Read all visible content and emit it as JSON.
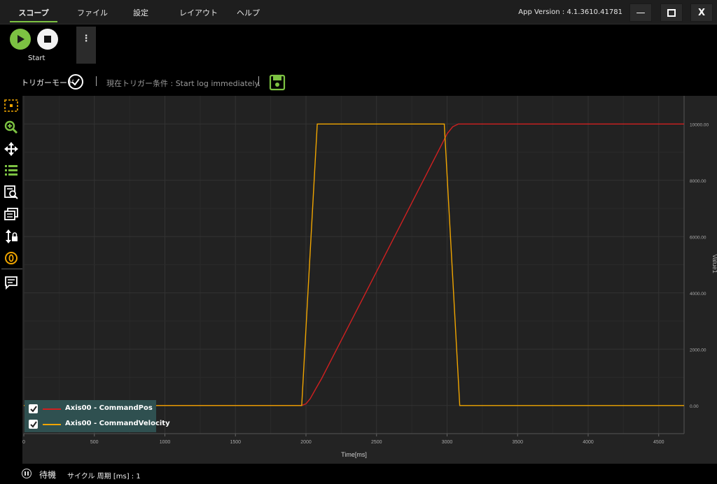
{
  "menu": {
    "scope": "スコープ",
    "file": "ファイル",
    "settings": "設定",
    "layout": "レイアウト",
    "help": "ヘルプ"
  },
  "app_version": "App Version : 4.1.3610.41781",
  "window_buttons": {
    "minimize": "—",
    "maximize": "□",
    "close": "X"
  },
  "toolbar": {
    "start_label": "Start",
    "more": "⋮"
  },
  "trigger": {
    "mode_label": "トリガーモード",
    "condition": "現在トリガー条件 : Start log immediately."
  },
  "tools": [
    "fit-view-icon",
    "zoom-icon",
    "pan-icon",
    "list-icon",
    "search-data-icon",
    "gallery-icon",
    "axis-lock-icon",
    "zero-icon",
    "comment-icon"
  ],
  "legend": [
    {
      "label": "Axis00 - CommandPos",
      "color": "#d02020",
      "checked": true
    },
    {
      "label": "Axis00 - CommandVelocity",
      "color": "#f0a500",
      "checked": true
    }
  ],
  "status": {
    "state": "待機",
    "cycle": "サイクル 周期 [ms] : 1"
  },
  "colors": {
    "accent": "#7cc242",
    "pos": "#d02020",
    "vel": "#f0a500"
  },
  "chart_data": {
    "type": "line",
    "xlabel": "Time[ms]",
    "ylabel": "Value1",
    "xlim": [
      0,
      4680
    ],
    "ylim": [
      -1000,
      11000
    ],
    "x_ticks": [
      "0",
      "500",
      "1000",
      "1500",
      "2000",
      "2500",
      "3000",
      "3500",
      "4000",
      "4500"
    ],
    "y_ticks": [
      "0.00",
      "2000.00",
      "4000.00",
      "6000.00",
      "8000.00",
      "10000.00"
    ],
    "grid": true,
    "legend_position": "bottom-left",
    "series": [
      {
        "name": "Axis00 - CommandPos",
        "x": [
          0,
          1970,
          2000,
          2030,
          2070,
          2110,
          2500,
          2960,
          3000,
          3040,
          3080,
          4680
        ],
        "y": [
          0,
          0,
          60,
          240,
          600,
          950,
          4750,
          9250,
          9650,
          9900,
          10000,
          10000
        ]
      },
      {
        "name": "Axis00 - CommandVelocity",
        "x": [
          0,
          1970,
          2080,
          2980,
          3090,
          4680
        ],
        "y": [
          0,
          0,
          10000,
          10000,
          0,
          0
        ]
      }
    ]
  }
}
